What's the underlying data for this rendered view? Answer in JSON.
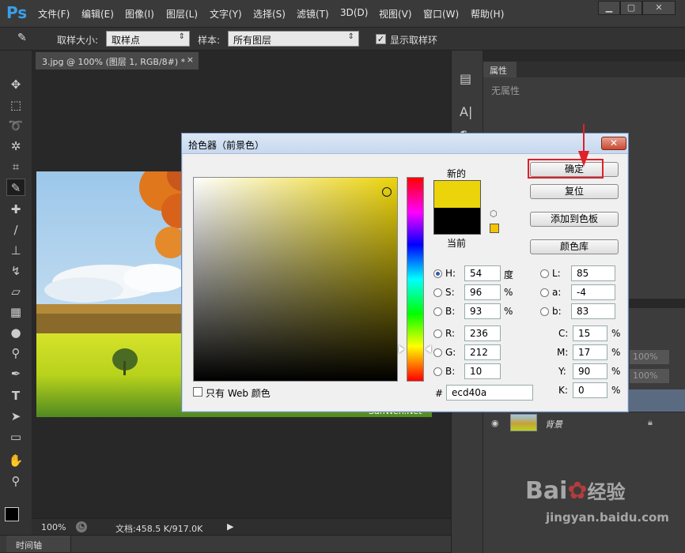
{
  "app": {
    "logo": "Ps",
    "icon": "photoshop-logo"
  },
  "menu": [
    "文件(F)",
    "编辑(E)",
    "图像(I)",
    "图层(L)",
    "文字(Y)",
    "选择(S)",
    "滤镜(T)",
    "3D(D)",
    "视图(V)",
    "窗口(W)",
    "帮助(H)"
  ],
  "window_controls": {
    "minimize": "▁",
    "maximize": "▢",
    "close": "✕"
  },
  "options": {
    "sample_size_label": "取样大小:",
    "sample_size_value": "取样点",
    "sample_label": "样本:",
    "sample_value": "所有图层",
    "show_ring_label": "显示取样环",
    "show_ring_checked": true
  },
  "document_tab": {
    "title": "3.jpg @ 100% (图层 1, RGB/8#) *",
    "close": "×"
  },
  "status": {
    "zoom": "100%",
    "doc_info": "文档:458.5 K/917.0K"
  },
  "timeline": {
    "label": "时间轴"
  },
  "properties_panel": {
    "tab": "属性",
    "empty_text": "无属性"
  },
  "layers_panel": {
    "opacity_value": "100%",
    "fill_value": "100%",
    "background_layer_name": "背景"
  },
  "canvas_watermark": "SanWen.Net",
  "dialog": {
    "title": "拾色器（前景色）",
    "new_label": "新的",
    "current_label": "当前",
    "buttons": {
      "ok": "确定",
      "reset": "复位",
      "add_to_swatches": "添加到色板",
      "color_libraries": "颜色库"
    },
    "fields": {
      "H": {
        "label": "H:",
        "value": "54",
        "unit": "度"
      },
      "S": {
        "label": "S:",
        "value": "96",
        "unit": "%"
      },
      "B": {
        "label": "B:",
        "value": "93",
        "unit": "%"
      },
      "R": {
        "label": "R:",
        "value": "236"
      },
      "G": {
        "label": "G:",
        "value": "212"
      },
      "Bb": {
        "label": "B:",
        "value": "10"
      },
      "L": {
        "label": "L:",
        "value": "85"
      },
      "a": {
        "label": "a:",
        "value": "-4"
      },
      "b": {
        "label": "b:",
        "value": "83"
      },
      "C": {
        "label": "C:",
        "value": "15",
        "unit": "%"
      },
      "M": {
        "label": "M:",
        "value": "17",
        "unit": "%"
      },
      "Y": {
        "label": "Y:",
        "value": "90",
        "unit": "%"
      },
      "K": {
        "label": "K:",
        "value": "0",
        "unit": "%"
      }
    },
    "hex_label": "#",
    "hex_value": "ecd40a",
    "web_only_label": "只有 Web 颜色",
    "colors": {
      "new": "#ecd40a",
      "current": "#000000",
      "websafe": "#f5c400"
    }
  },
  "watermark": {
    "brand": "Bai",
    "brand2": "经验",
    "url": "jingyan.baidu.com"
  }
}
